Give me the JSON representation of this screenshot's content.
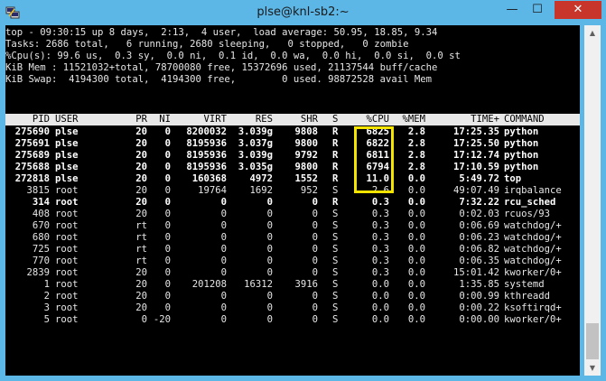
{
  "window": {
    "title": "plse@knl-sb2:~",
    "min_label": "—",
    "max_label": "☐",
    "close_label": "✕"
  },
  "summary": [
    "top - 09:30:15 up 8 days,  2:13,  4 user,  load average: 50.95, 18.85, 9.34",
    "Tasks: 2686 total,   6 running, 2680 sleeping,   0 stopped,   0 zombie",
    "%Cpu(s): 99.6 us,  0.3 sy,  0.0 ni,  0.1 id,  0.0 wa,  0.0 hi,  0.0 si,  0.0 st",
    "KiB Mem : 11521032+total, 78700080 free, 15372696 used, 21137544 buff/cache",
    "KiB Swap:  4194300 total,  4194300 free,        0 used. 98872528 avail Mem"
  ],
  "columns": [
    "PID",
    "USER",
    "PR",
    "NI",
    "VIRT",
    "RES",
    "SHR",
    "S",
    "%CPU",
    "%MEM",
    "TIME+",
    "COMMAND"
  ],
  "processes": [
    {
      "pid": "275690",
      "user": "plse",
      "pr": "20",
      "ni": "0",
      "virt": "8200032",
      "res": "3.039g",
      "shr": "9808",
      "s": "R",
      "cpu": "6825",
      "mem": "2.8",
      "time": "17:25.35",
      "cmd": "python",
      "bold": true
    },
    {
      "pid": "275691",
      "user": "plse",
      "pr": "20",
      "ni": "0",
      "virt": "8195936",
      "res": "3.037g",
      "shr": "9800",
      "s": "R",
      "cpu": "6822",
      "mem": "2.8",
      "time": "17:25.50",
      "cmd": "python",
      "bold": true
    },
    {
      "pid": "275689",
      "user": "plse",
      "pr": "20",
      "ni": "0",
      "virt": "8195936",
      "res": "3.039g",
      "shr": "9792",
      "s": "R",
      "cpu": "6811",
      "mem": "2.8",
      "time": "17:12.74",
      "cmd": "python",
      "bold": true
    },
    {
      "pid": "275688",
      "user": "plse",
      "pr": "20",
      "ni": "0",
      "virt": "8195936",
      "res": "3.035g",
      "shr": "9800",
      "s": "R",
      "cpu": "6794",
      "mem": "2.8",
      "time": "17:10.59",
      "cmd": "python",
      "bold": true
    },
    {
      "pid": "272818",
      "user": "plse",
      "pr": "20",
      "ni": "0",
      "virt": "160368",
      "res": "4972",
      "shr": "1552",
      "s": "R",
      "cpu": "11.0",
      "mem": "0.0",
      "time": "5:49.72",
      "cmd": "top",
      "bold": true
    },
    {
      "pid": "3815",
      "user": "root",
      "pr": "20",
      "ni": "0",
      "virt": "19764",
      "res": "1692",
      "shr": "952",
      "s": "S",
      "cpu": "2.6",
      "mem": "0.0",
      "time": "49:07.49",
      "cmd": "irqbalance",
      "bold": false
    },
    {
      "pid": "314",
      "user": "root",
      "pr": "20",
      "ni": "0",
      "virt": "0",
      "res": "0",
      "shr": "0",
      "s": "R",
      "cpu": "0.3",
      "mem": "0.0",
      "time": "7:32.22",
      "cmd": "rcu_sched",
      "bold": true
    },
    {
      "pid": "408",
      "user": "root",
      "pr": "20",
      "ni": "0",
      "virt": "0",
      "res": "0",
      "shr": "0",
      "s": "S",
      "cpu": "0.3",
      "mem": "0.0",
      "time": "0:02.03",
      "cmd": "rcuos/93",
      "bold": false
    },
    {
      "pid": "670",
      "user": "root",
      "pr": "rt",
      "ni": "0",
      "virt": "0",
      "res": "0",
      "shr": "0",
      "s": "S",
      "cpu": "0.3",
      "mem": "0.0",
      "time": "0:06.69",
      "cmd": "watchdog/+",
      "bold": false
    },
    {
      "pid": "680",
      "user": "root",
      "pr": "rt",
      "ni": "0",
      "virt": "0",
      "res": "0",
      "shr": "0",
      "s": "S",
      "cpu": "0.3",
      "mem": "0.0",
      "time": "0:06.23",
      "cmd": "watchdog/+",
      "bold": false
    },
    {
      "pid": "725",
      "user": "root",
      "pr": "rt",
      "ni": "0",
      "virt": "0",
      "res": "0",
      "shr": "0",
      "s": "S",
      "cpu": "0.3",
      "mem": "0.0",
      "time": "0:06.82",
      "cmd": "watchdog/+",
      "bold": false
    },
    {
      "pid": "770",
      "user": "root",
      "pr": "rt",
      "ni": "0",
      "virt": "0",
      "res": "0",
      "shr": "0",
      "s": "S",
      "cpu": "0.3",
      "mem": "0.0",
      "time": "0:06.35",
      "cmd": "watchdog/+",
      "bold": false
    },
    {
      "pid": "2839",
      "user": "root",
      "pr": "20",
      "ni": "0",
      "virt": "0",
      "res": "0",
      "shr": "0",
      "s": "S",
      "cpu": "0.3",
      "mem": "0.0",
      "time": "15:01.42",
      "cmd": "kworker/0+",
      "bold": false
    },
    {
      "pid": "1",
      "user": "root",
      "pr": "20",
      "ni": "0",
      "virt": "201208",
      "res": "16312",
      "shr": "3916",
      "s": "S",
      "cpu": "0.0",
      "mem": "0.0",
      "time": "1:35.85",
      "cmd": "systemd",
      "bold": false
    },
    {
      "pid": "2",
      "user": "root",
      "pr": "20",
      "ni": "0",
      "virt": "0",
      "res": "0",
      "shr": "0",
      "s": "S",
      "cpu": "0.0",
      "mem": "0.0",
      "time": "0:00.99",
      "cmd": "kthreadd",
      "bold": false
    },
    {
      "pid": "3",
      "user": "root",
      "pr": "20",
      "ni": "0",
      "virt": "0",
      "res": "0",
      "shr": "0",
      "s": "S",
      "cpu": "0.0",
      "mem": "0.0",
      "time": "0:00.22",
      "cmd": "ksoftirqd+",
      "bold": false
    },
    {
      "pid": "5",
      "user": "root",
      "pr": "0",
      "ni": "-20",
      "virt": "0",
      "res": "0",
      "shr": "0",
      "s": "S",
      "cpu": "0.0",
      "mem": "0.0",
      "time": "0:00.00",
      "cmd": "kworker/0+",
      "bold": false
    }
  ],
  "scrollbar": {
    "up": "▲",
    "down": "▼"
  },
  "colors": {
    "titlebar": "#5cb6e6",
    "close": "#c7352b",
    "highlight": "#f5e400",
    "terminal_bg": "#000000"
  }
}
